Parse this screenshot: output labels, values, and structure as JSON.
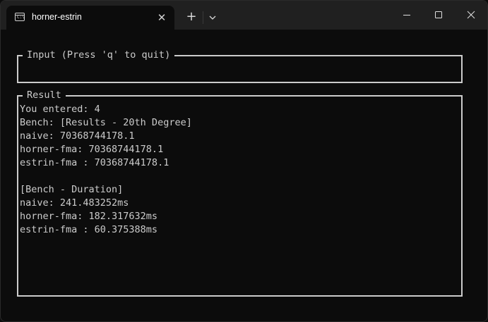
{
  "window": {
    "tab_title": "horner-estrin",
    "tab_icon": "terminal-icon",
    "close_tab_glyph": "✕",
    "new_tab_glyph": "+",
    "controls": {
      "minimize": "minimize-icon",
      "maximize": "maximize-icon",
      "close": "close-icon"
    }
  },
  "input_panel": {
    "title": "Input (Press 'q' to quit)",
    "value": ""
  },
  "result_panel": {
    "title": "Result",
    "lines": [
      "You entered: 4",
      "Bench: [Results - 20th Degree]",
      "naive: 70368744178.1",
      "horner-fma: 70368744178.1",
      "estrin-fma : 70368744178.1",
      "",
      "[Bench - Duration]",
      "naive: 241.483252ms",
      "horner-fma: 182.317632ms",
      "estrin-fma : 60.375388ms"
    ]
  },
  "colors": {
    "background": "#0c0c0c",
    "titlebar": "#202020",
    "text": "#cccccc"
  }
}
